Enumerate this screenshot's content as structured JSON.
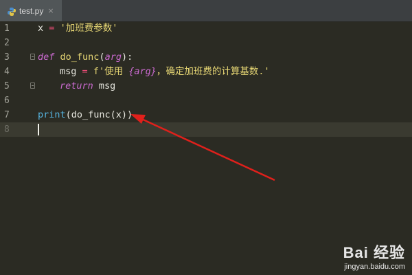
{
  "tabs": [
    {
      "label": "test.py",
      "close": "×",
      "icon": "python-file-icon"
    }
  ],
  "lines": [
    {
      "num": "1"
    },
    {
      "num": "2"
    },
    {
      "num": "3"
    },
    {
      "num": "4"
    },
    {
      "num": "5"
    },
    {
      "num": "6"
    },
    {
      "num": "7"
    },
    {
      "num": "8"
    }
  ],
  "code": {
    "l1": {
      "var": "x",
      "op": "=",
      "str": "'加班费参数'"
    },
    "l3": {
      "kw": "def",
      "name": "do_func",
      "open": "(",
      "param": "arg",
      "close": "):"
    },
    "l4": {
      "var": "msg",
      "op": "=",
      "str_a": "f'使用 ",
      "interp": "{arg}",
      "str_b": "，确定加班费的计算基数.'"
    },
    "l5": {
      "kw": "return",
      "var": "msg"
    },
    "l7": {
      "builtin": "print",
      "rest": "(do_func(x))"
    }
  },
  "annotation": {
    "type": "arrow",
    "color": "#e0201b",
    "points_to": "print(do_func(x))"
  },
  "watermark": {
    "brand": "Bai 经验",
    "url": "jingyan.baidu.com"
  },
  "colors": {
    "background": "#2b2b23",
    "keyword": "#cc6bd1",
    "string": "#e6d674",
    "operator": "#ee4d77",
    "builtin": "#56b4e0",
    "line_numbers": "#a3a39a"
  }
}
